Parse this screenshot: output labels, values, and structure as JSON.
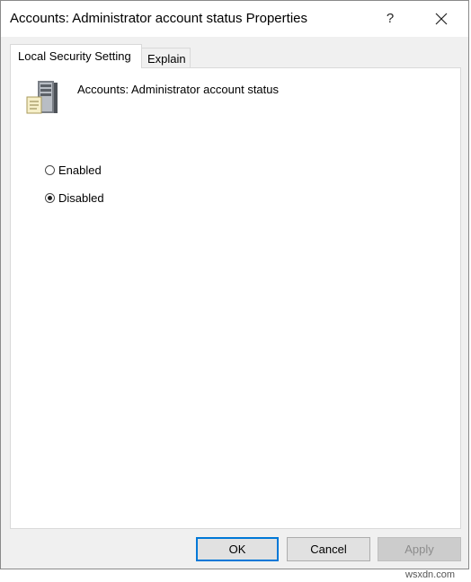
{
  "window": {
    "title": "Accounts: Administrator account status Properties",
    "help_label": "?"
  },
  "tabs": [
    {
      "label": "Local Security Setting",
      "selected": true
    },
    {
      "label": "Explain",
      "selected": false
    }
  ],
  "policy": {
    "name": "Accounts: Administrator account status",
    "icon": "server-policy-icon"
  },
  "options": [
    {
      "label": "Enabled",
      "checked": false
    },
    {
      "label": "Disabled",
      "checked": true
    }
  ],
  "buttons": {
    "ok": "OK",
    "cancel": "Cancel",
    "apply": "Apply"
  },
  "watermark": "wsxdn.com",
  "colors": {
    "accent": "#0078d7",
    "window_bg": "#f0f0f0",
    "panel_bg": "#ffffff"
  }
}
